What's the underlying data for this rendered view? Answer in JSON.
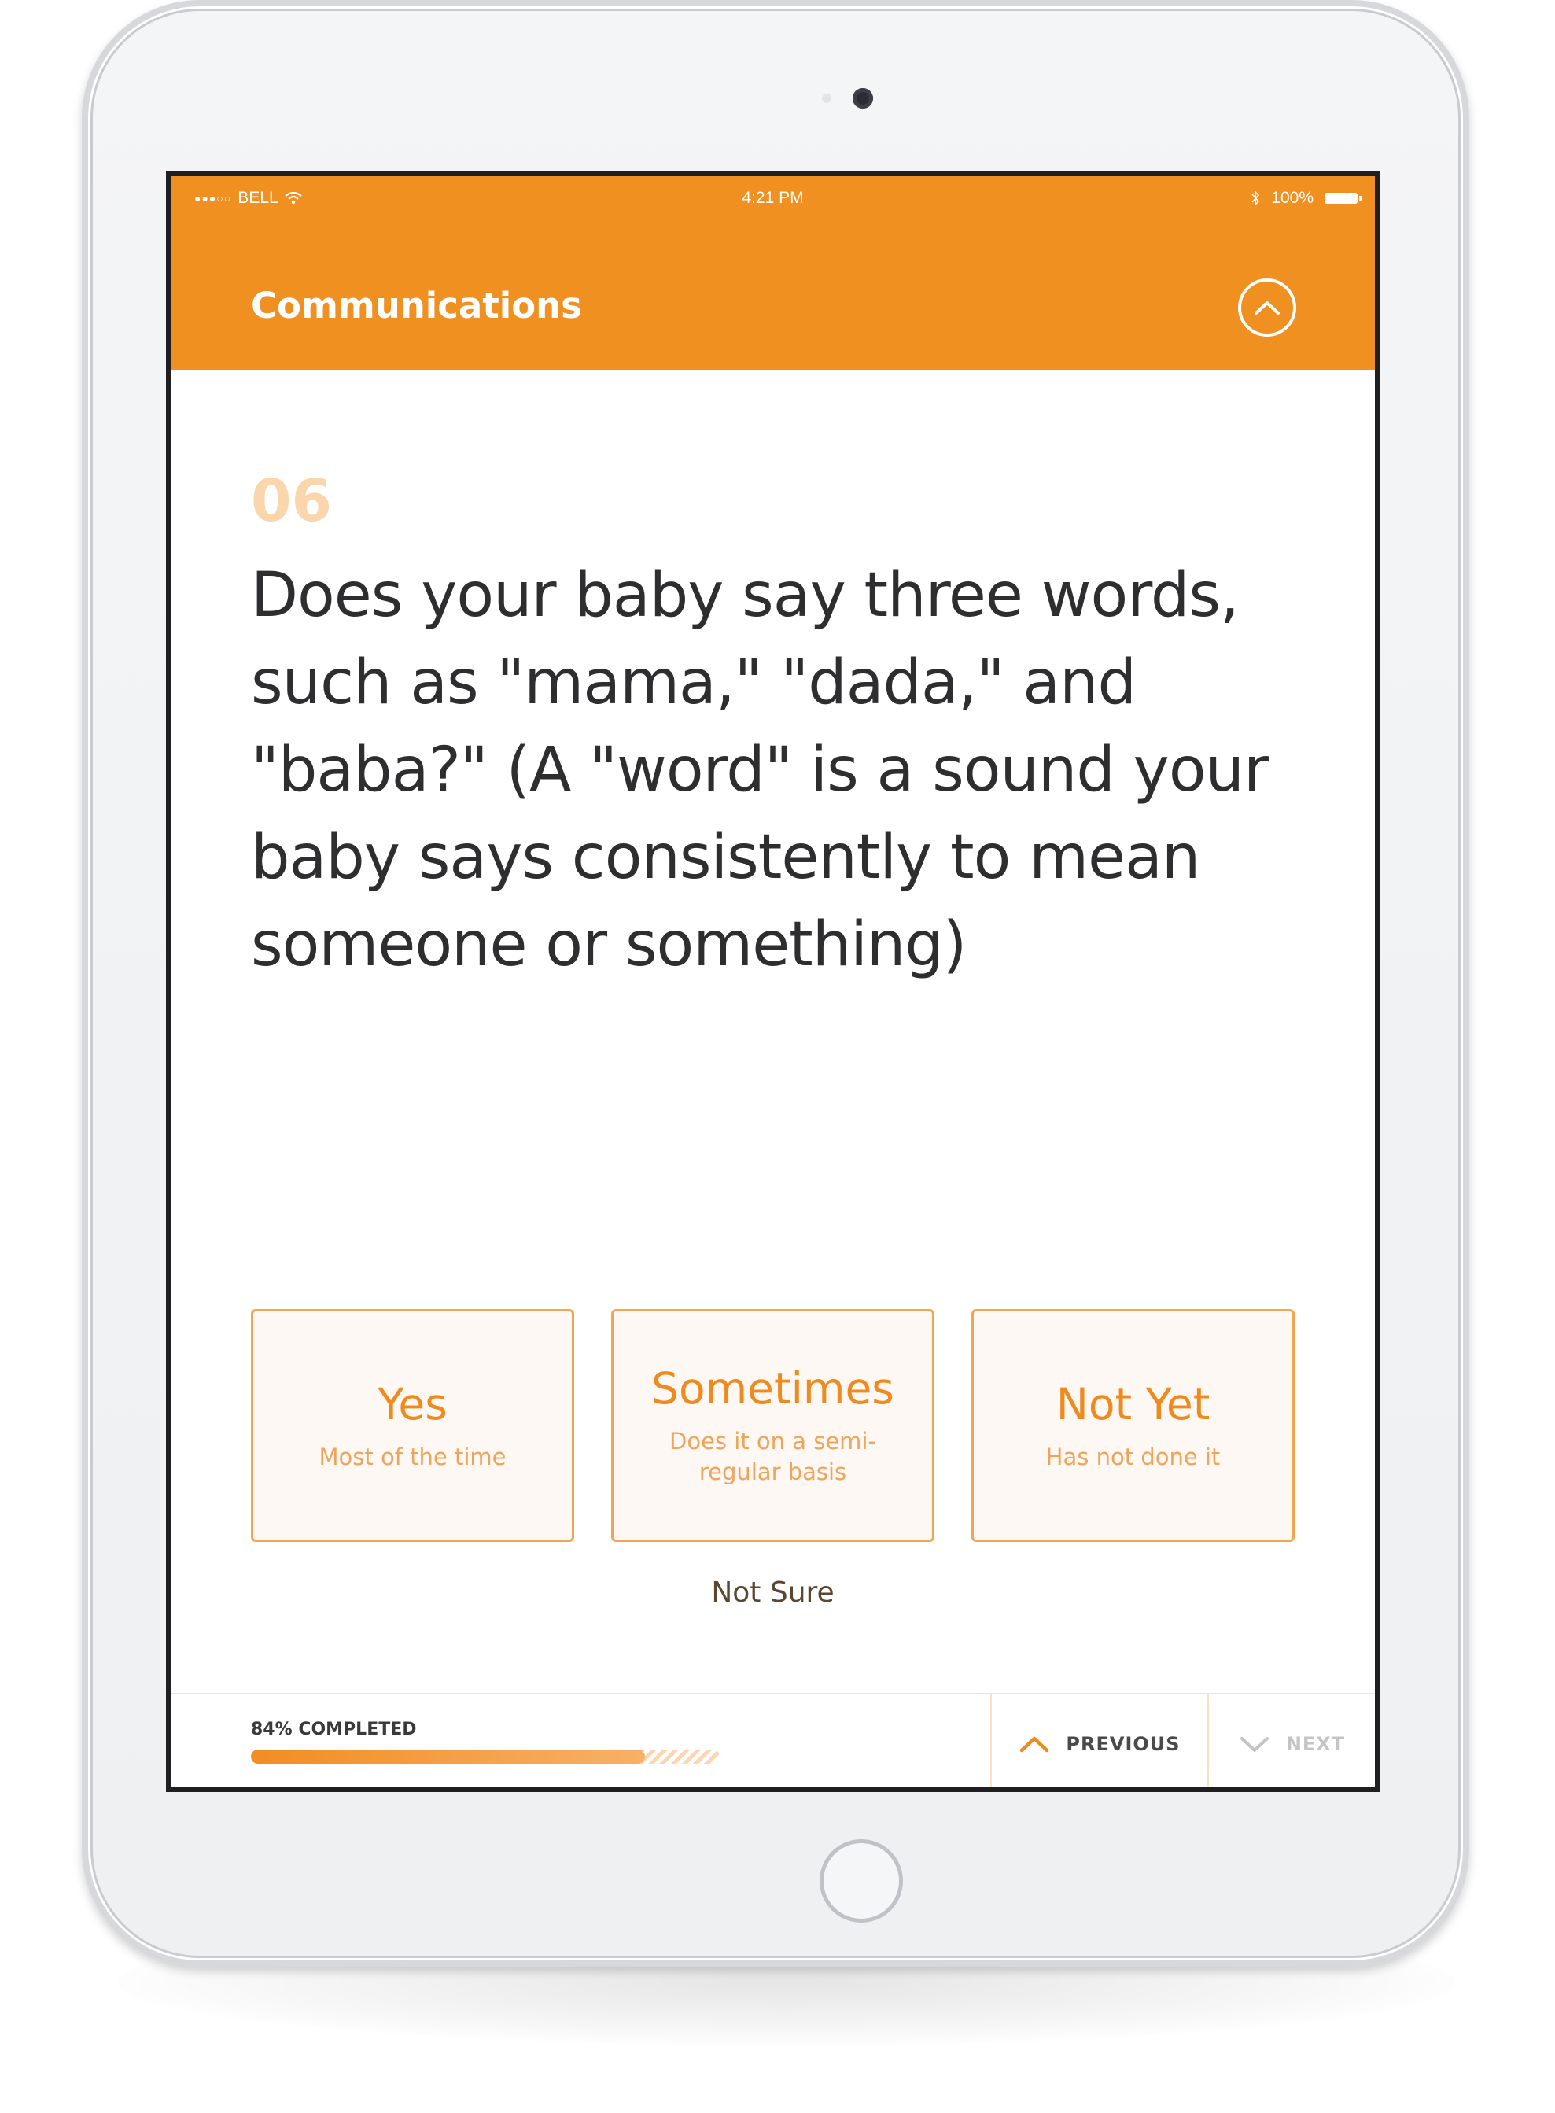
{
  "status_bar": {
    "carrier": "BELL",
    "signal_icon": "signal-dots-icon",
    "wifi_icon": "wifi-icon",
    "time": "4:21 PM",
    "bluetooth_icon": "bluetooth-icon",
    "battery": "100%",
    "battery_icon": "battery-icon"
  },
  "header": {
    "title": "Communications",
    "collapse_icon": "chevron-up-icon",
    "background_color": "#f09021"
  },
  "question": {
    "number": "06",
    "text": "Does your baby say three words, such as \"mama,\" \"dada,\" and \"baba?\" (A \"word\" is a sound your baby says consistently to mean someone or something)"
  },
  "answers": [
    {
      "label": "Yes",
      "sublabel": "Most of the time"
    },
    {
      "label": "Sometimes",
      "sublabel": "Does it on a semi-regular basis"
    },
    {
      "label": "Not Yet",
      "sublabel": "Has not done it"
    }
  ],
  "not_sure_label": "Not Sure",
  "footer": {
    "progress_label": "84% COMPLETED",
    "progress_value": 0.84,
    "previous_label": "PREVIOUS",
    "previous_icon": "chevron-up-icon",
    "next_label": "NEXT",
    "next_icon": "chevron-down-icon",
    "accent_color": "#ef8b1e"
  }
}
